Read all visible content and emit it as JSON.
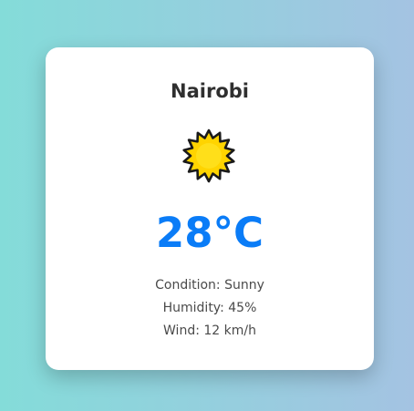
{
  "weather": {
    "city": "Nairobi",
    "icon": "sun-icon",
    "temperature": "28°C",
    "condition_label": "Condition:",
    "condition": "Sunny",
    "humidity_label": "Humidity:",
    "humidity": "45%",
    "wind_label": "Wind:",
    "wind": "12 km/h"
  },
  "colors": {
    "background_start": "#84dcd9",
    "background_end": "#a4c3e2",
    "temperature": "#0a7cf7",
    "sun_fill": "#ffd400",
    "sun_stroke": "#1a1a1a"
  }
}
